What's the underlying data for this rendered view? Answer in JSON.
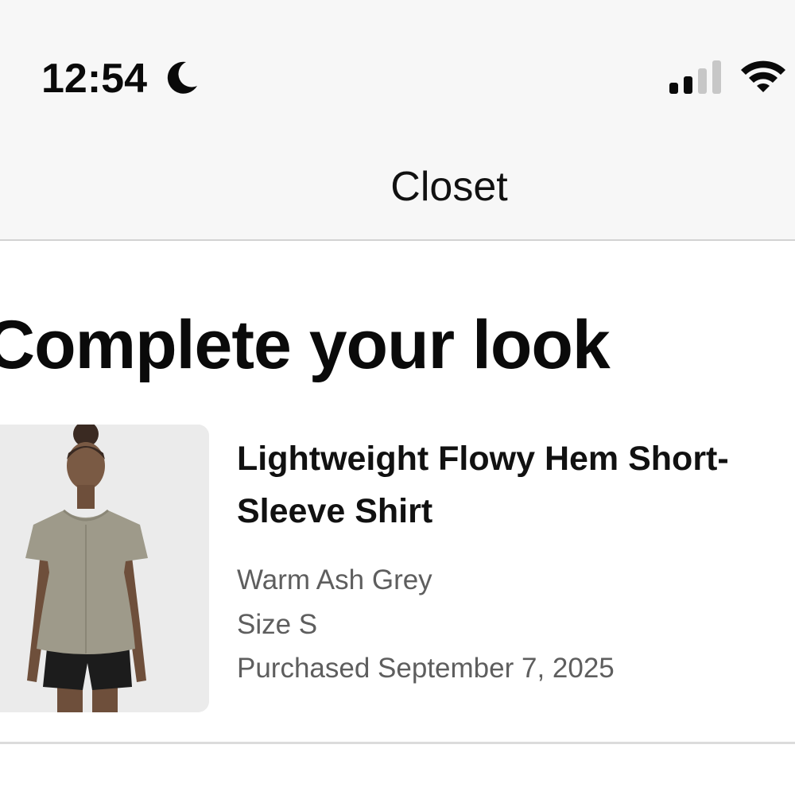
{
  "status_bar": {
    "time": "12:54",
    "focus_icon": "moon-icon",
    "signal_icon": "cellular-signal-icon",
    "wifi_icon": "wifi-icon"
  },
  "header": {
    "title": "Closet"
  },
  "section": {
    "heading": "Complete your look"
  },
  "product": {
    "name": "Lightweight Flowy Hem Short-Sleeve Shirt",
    "color": "Warm Ash Grey",
    "size": "Size S",
    "purchased": "Purchased September 7, 2025",
    "image": "product-photo-model-in-grey-tee"
  },
  "colors": {
    "header_background": "#f7f7f7",
    "text_primary": "#111111",
    "text_secondary": "#5e5e5e",
    "divider": "#dcdcdc",
    "thumbnail_background": "#ebebeb"
  }
}
